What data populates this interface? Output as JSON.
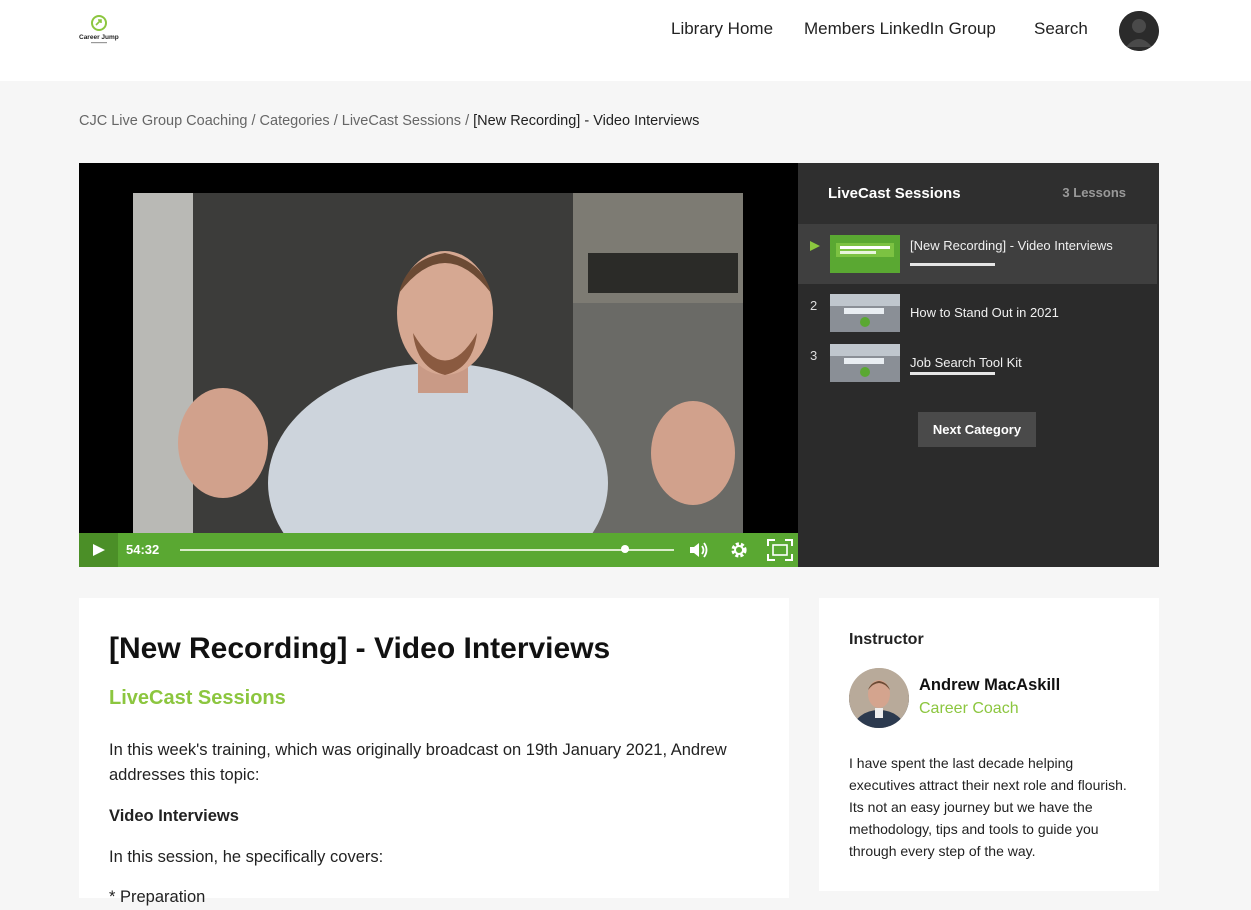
{
  "header": {
    "logo_text": "Career Jump",
    "nav": [
      "Library Home",
      "Members LinkedIn Group",
      "Search"
    ]
  },
  "breadcrumb": {
    "items": [
      "CJC Live Group Coaching",
      "Categories",
      "LiveCast Sessions"
    ],
    "separator": "/",
    "current": "[New Recording] - Video Interviews"
  },
  "player": {
    "time": "54:32",
    "progress": 0.9,
    "accent": "#5aa832"
  },
  "sidebar": {
    "title": "LiveCast Sessions",
    "count": "3 Lessons",
    "lessons": [
      {
        "number": "",
        "title": "[New Recording] - Video Interviews",
        "active": true,
        "progress": 1.0
      },
      {
        "number": "2",
        "title": "How to Stand Out in 2021",
        "active": false,
        "progress": 0.0
      },
      {
        "number": "3",
        "title": "Job Search Tool Kit",
        "active": false,
        "progress": 1.0
      }
    ],
    "next_button": "Next Category"
  },
  "content": {
    "title": "[New Recording] - Video Interviews",
    "category": "LiveCast Sessions",
    "paragraphs": [
      "In this week's training, which was originally broadcast on 19th January 2021, Andrew addresses this topic:",
      "Video Interviews",
      "In this session, he specifically covers:",
      "* Preparation"
    ],
    "accent": "#8cc63f"
  },
  "instructor": {
    "heading": "Instructor",
    "name": "Andrew MacAskill",
    "role": "Career Coach",
    "bio": "I have spent the last decade helping executives attract their next role and flourish. Its not an easy journey but we have the methodology, tips and tools to guide you through every step of the way."
  }
}
